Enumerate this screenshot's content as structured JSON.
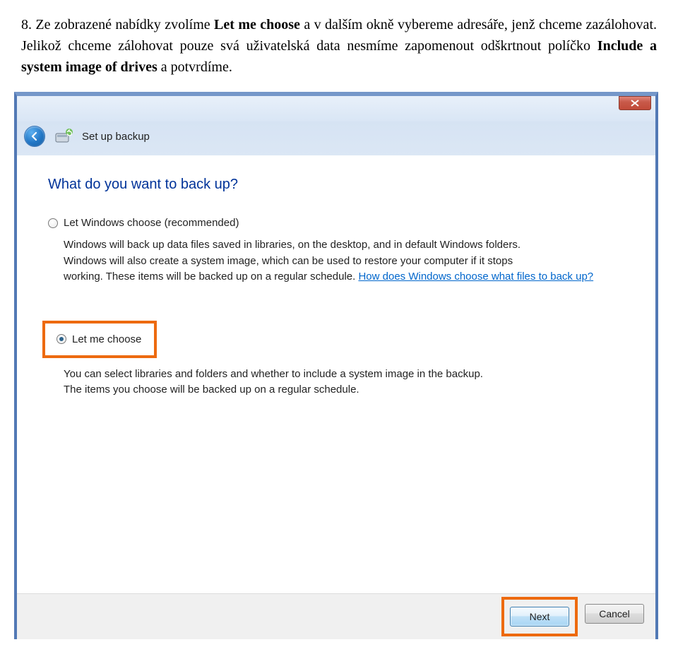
{
  "intro": {
    "number": "8.",
    "pre": "Ze  zobrazené  nabídky  zvolíme  ",
    "bold1": "Let me choose",
    "mid1": " a  v dalším  okně  vybereme  adresáře,  jenž chceme zazálohovat. Jelikož chceme zálohovat pouze svá uživatelská data nesmíme zapomenout odškrtnout políčko ",
    "bold2": "Include a system image of drives",
    "post": " a potvrdíme."
  },
  "dialog": {
    "navTitle": "Set up backup",
    "heading": "What do you want to back up?",
    "option1": {
      "label": "Let Windows choose (recommended)",
      "desc_line1": "Windows will back up data files saved in libraries, on the desktop, and in default Windows folders.",
      "desc_line2": "Windows will also create a system image, which can be used to restore your computer if it stops",
      "desc_line3_a": "working. These items will be backed up on a regular schedule. ",
      "desc_link": "How does Windows choose what files to back up?"
    },
    "option2": {
      "label": "Let me choose",
      "desc_line1": "You can select libraries and folders and whether to include a system image in the backup.",
      "desc_line2": "The items you choose will be backed up on a regular schedule."
    },
    "buttons": {
      "next": "Next",
      "cancel": "Cancel"
    }
  }
}
